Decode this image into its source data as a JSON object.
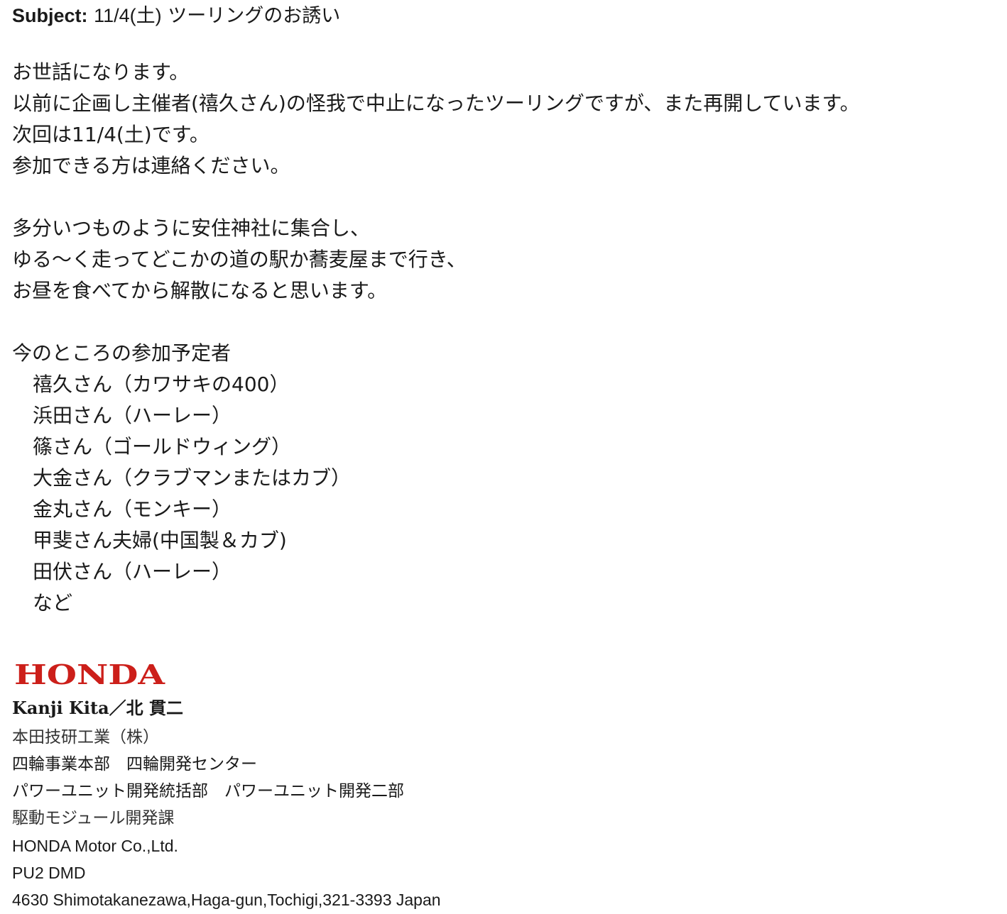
{
  "colors": {
    "text": "#1a1a1a",
    "brand": "#cc1f1a",
    "background": "#ffffff"
  },
  "subject": {
    "label": "Subject:",
    "date": "11/4(土)",
    "text": "ツーリングのお誘い"
  },
  "body": {
    "paragraph1": [
      "お世話になります。",
      "以前に企画し主催者(禧久さん)の怪我で中止になったツーリングですが、また再開しています。",
      "次回は11/4(土)です。",
      "参加できる方は連絡ください。"
    ],
    "paragraph2": [
      "多分いつものように安住神社に集合し、",
      "ゆる〜く走ってどこかの道の駅か蕎麦屋まで行き、",
      "お昼を食べてから解散になると思います。"
    ],
    "participants_heading": "今のところの参加予定者",
    "participants": [
      "禧久さん（カワサキの400）",
      "浜田さん（ハーレー）",
      "篠さん（ゴールドウィング）",
      "大金さん（クラブマンまたはカブ）",
      "金丸さん（モンキー）",
      "甲斐さん夫婦(中国製＆カブ)",
      "田伏さん（ハーレー）",
      "など"
    ]
  },
  "signature": {
    "logo_text": "HONDA",
    "name": "Kanji Kita／北 貫二",
    "company_jp": "本田技研工業（株）",
    "division": "四輪事業本部　四輪開発センター",
    "department": "パワーユニット開発統括部　パワーユニット開発二部",
    "section": "駆動モジュール開発課",
    "company_en": "HONDA Motor Co.,Ltd.",
    "dept_en": "PU2 DMD",
    "address": "4630 Shimotakanezawa,Haga-gun,Tochigi,321-3393 Japan"
  }
}
